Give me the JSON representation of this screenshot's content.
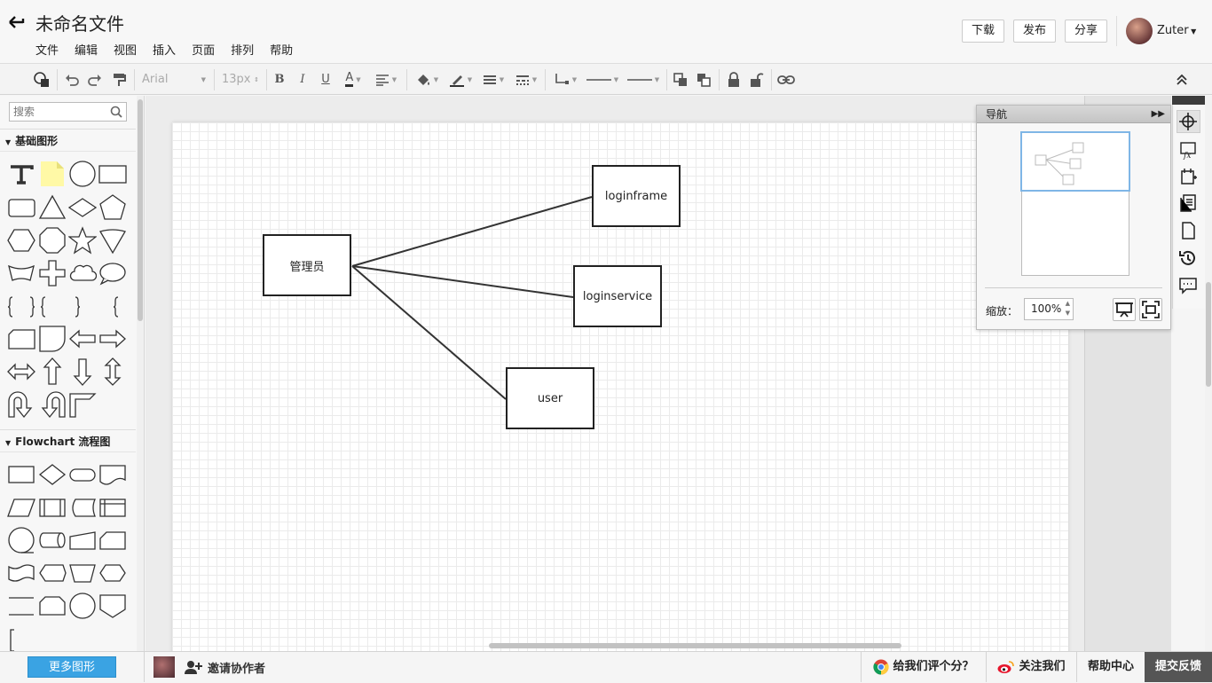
{
  "header": {
    "title": "未命名文件",
    "menu": [
      "文件",
      "编辑",
      "视图",
      "插入",
      "页面",
      "排列",
      "帮助"
    ],
    "buttons": {
      "download": "下载",
      "publish": "发布",
      "share": "分享"
    },
    "user": "Zuter"
  },
  "toolbar": {
    "font_family": "Arial",
    "font_size": "13px",
    "icons": [
      "shape-style-icon",
      "undo-icon",
      "redo-icon",
      "format-painter-icon",
      "bold-icon",
      "italic-icon",
      "underline-icon",
      "font-color-icon",
      "align-icon",
      "fill-color-icon",
      "line-color-icon",
      "line-width-icon",
      "line-style-icon",
      "connector-icon",
      "start-arrow-icon",
      "end-arrow-icon",
      "bring-front-icon",
      "send-back-icon",
      "lock-icon",
      "unlock-icon",
      "link-icon",
      "collapse-icon"
    ]
  },
  "left_panel": {
    "search_placeholder": "搜索",
    "sections": [
      {
        "title": "基础图形"
      },
      {
        "title": "Flowchart 流程图"
      }
    ],
    "more_shapes": "更多图形"
  },
  "diagram": {
    "nodes": [
      {
        "id": "admin",
        "label": "管理员"
      },
      {
        "id": "loginframe",
        "label": "loginframe"
      },
      {
        "id": "loginservice",
        "label": "loginservice"
      },
      {
        "id": "user",
        "label": "user"
      }
    ],
    "edges": [
      [
        "admin",
        "loginframe"
      ],
      [
        "admin",
        "loginservice"
      ],
      [
        "admin",
        "user"
      ]
    ]
  },
  "navigator": {
    "title": "导航",
    "zoom_label": "缩放：",
    "zoom_value": "100%"
  },
  "bottom": {
    "invite": "邀请协作者",
    "rate": "给我们评个分？",
    "follow": "关注我们",
    "help": "帮助中心",
    "feedback": "提交反馈"
  },
  "colors": {
    "accent": "#3aa3e3",
    "feedback_bg": "#555555",
    "nav_view": "#7fb6e6"
  }
}
